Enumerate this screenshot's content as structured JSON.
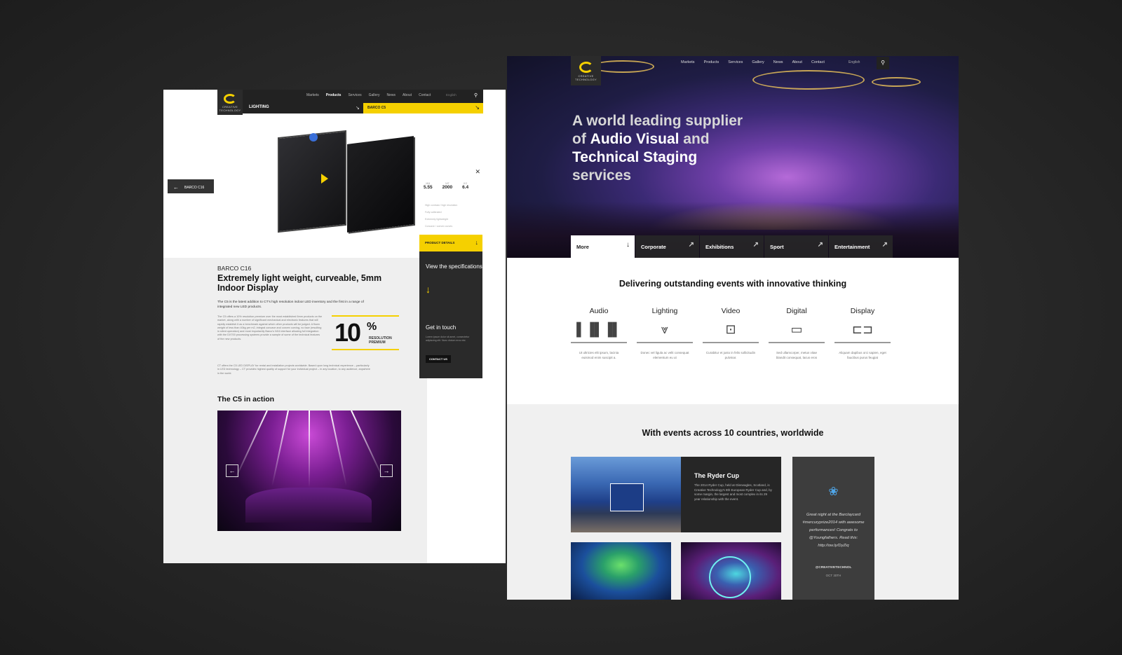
{
  "left_page": {
    "nav": {
      "logo_text": "CREATIVE TECHNOLOGY",
      "links": [
        "Markets",
        "Products",
        "Services",
        "Gallery",
        "News",
        "About",
        "Contact"
      ],
      "active_link": "Products",
      "language": "English",
      "category_label": "LIGHTING",
      "product_label": "BARCO C5"
    },
    "back_button": "BARCO C16",
    "specs": {
      "values": [
        {
          "value": "5.55",
          "unit": "MM"
        },
        {
          "value": "2000",
          "unit": "NIT"
        },
        {
          "value": "6.4",
          "unit": "KG"
        }
      ],
      "features": [
        "High contrast / high resolution",
        "Fully calibrated",
        "Extremely lightweight",
        "Concave / convex curves"
      ]
    },
    "product_details_label": "PRODUCT DETAILS",
    "view_specs_label": "View the specifications",
    "get_in_touch": {
      "title": "Get in touch",
      "text": "Lorem ipsum dolor sit amet, consectetur adipiscing elit. Nunc dictum eros nisi.",
      "button": "CONTACT US"
    },
    "product": {
      "brand": "BARCO C16",
      "headline": "Extremely light weight, curveable, 5mm Indoor Display",
      "intro": "The C5 is the latest addition to CT's high resolution indoor LED inventory and the first in a range of integrated new LED products.",
      "body1": "The C5 offers a 10% resolution premium over the most established 6mm products on the market, along with a number of significant mechanical and electronic features that will rapidly establish it as a benchmark against which other products will be judged. A flown weight of less than 40kg per m2, integral concave and convex curving, no face (resulting in silent operation) and most importantly Barco's NX4 interface allowing full integration with the DX700 processing systems provide a sample of some of the technical features of the new products.",
      "body2": "CT offers the C5 LED DISPLAY for rental and installation projects worldwide. Based upon long technical experience – particularly in LED technology – CT provides highest quality of support for your individual project – in any location, to any audience, anywhere in the world.",
      "premium_value": "10",
      "premium_unit": "%",
      "premium_label": "RESOLUTION PREMIUM"
    },
    "gallery_title": "The C5 in action"
  },
  "right_page": {
    "nav": {
      "logo_text": "CREATIVE TECHNOLOGY",
      "links": [
        "Markets",
        "Products",
        "Services",
        "Gallery",
        "News",
        "About",
        "Contact"
      ],
      "language": "English"
    },
    "hero": {
      "line1": "A world leading supplier",
      "line2a": "of ",
      "line2b": "Audio Visual",
      "line2c": " and",
      "line3": "Technical Staging",
      "line4": "services"
    },
    "tabs": [
      {
        "label": "More",
        "arrow": "↓"
      },
      {
        "label": "Corporate",
        "arrow": "↗"
      },
      {
        "label": "Exhibitions",
        "arrow": "↗"
      },
      {
        "label": "Sport",
        "arrow": "↗"
      },
      {
        "label": "Entertainment",
        "arrow": "↗"
      }
    ],
    "delivering_title": "Delivering outstanding events with innovative thinking",
    "categories": [
      {
        "name": "Audio",
        "icon": "equalizer-icon",
        "desc": "Ut ultricies elit ipsum, lacinia euismod enim suscipit a."
      },
      {
        "name": "Lighting",
        "icon": "stage-light-icon",
        "desc": "Donec vel ligula ac velit consequat elementum eu ut"
      },
      {
        "name": "Video",
        "icon": "camera-icon",
        "desc": "Curabitur et justo in felis sollicitudin pulvinar."
      },
      {
        "name": "Digital",
        "icon": "laptop-icon",
        "desc": "Sed ullamcorper, metus vitae blandit consequat, lacus eros"
      },
      {
        "name": "Display",
        "icon": "screen-icon",
        "desc": "Aliquam dapibus orci sapien, eget faucibus purus feugiat"
      }
    ],
    "worldwide_title": "With events across 10 countries, worldwide",
    "ryder": {
      "title": "The Ryder Cup",
      "text": "The 2014 Ryder Cup, held at Gleneagles, Scotland, is Creative Technology's 8th European Ryder Cup and, by some margin, the largest and most complex in its 29 year relationship with the event."
    },
    "tweet": {
      "text": "Great night at the Barclaycard #mercuryprize2014 with awesome performances! Congrats to @Youngfathers. Read this: http://ow.ly/DyZiq",
      "handle": "@CREATIVETECHNOL",
      "date": "OCT 30TH"
    }
  }
}
